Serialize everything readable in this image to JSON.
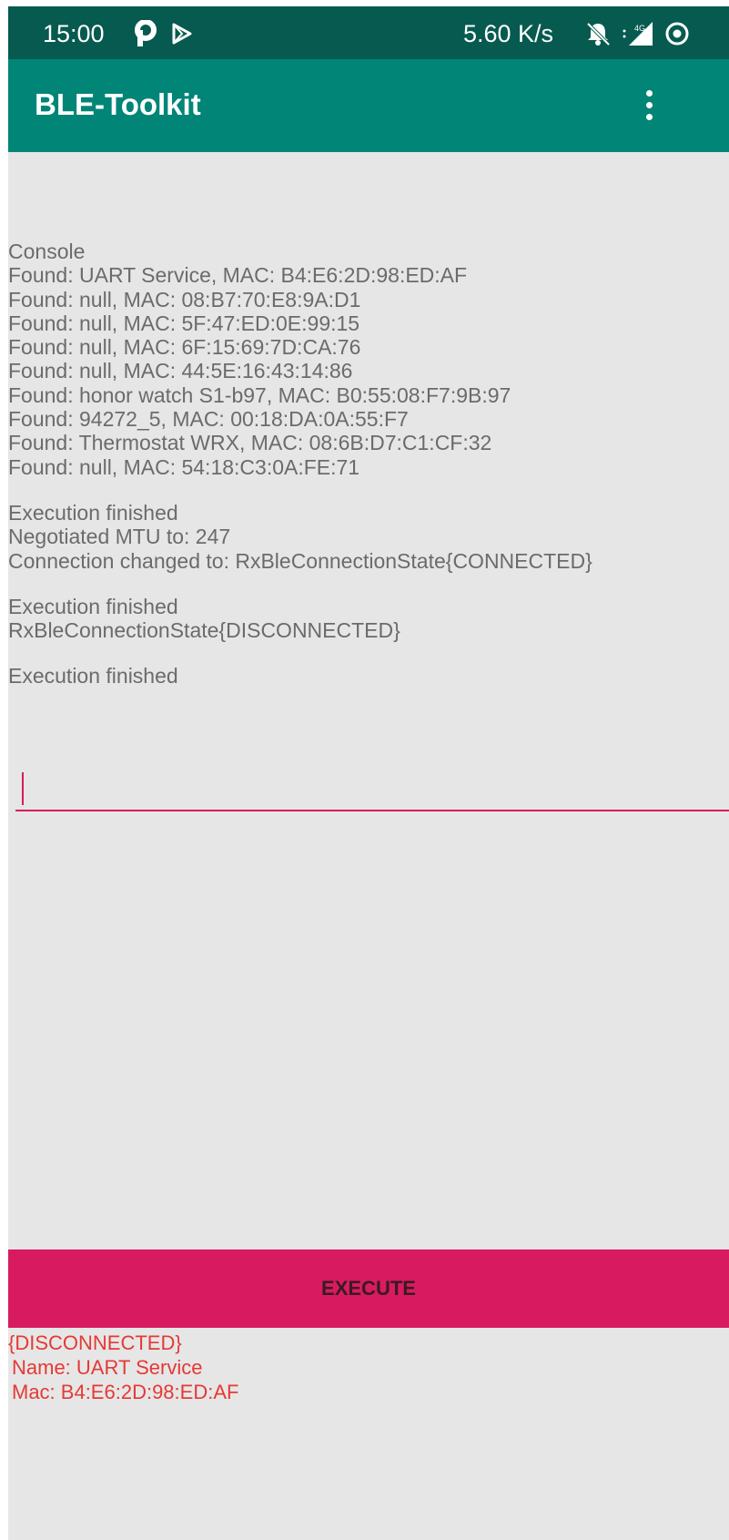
{
  "status_bar": {
    "time": "15:00",
    "net_speed": "5.60 K/s",
    "icons": [
      "parking-p-icon",
      "play-store-icon",
      "bell-off-icon",
      "signal-4g-icon",
      "sync-icon"
    ]
  },
  "app_bar": {
    "title": "BLE-Toolkit",
    "menu_icon": "more-vert-icon"
  },
  "console": {
    "header": "Console",
    "found_devices": [
      "Found: UART Service, MAC: B4:E6:2D:98:ED:AF",
      "Found: null, MAC: 08:B7:70:E8:9A:D1",
      "Found: null, MAC: 5F:47:ED:0E:99:15",
      "Found: null, MAC: 6F:15:69:7D:CA:76",
      "Found: null, MAC: 44:5E:16:43:14:86",
      "Found: honor watch S1-b97, MAC: B0:55:08:F7:9B:97",
      "Found: 94272_5, MAC: 00:18:DA:0A:55:F7",
      "Found: Thermostat WRX, MAC: 08:6B:D7:C1:CF:32",
      "Found: null, MAC: 54:18:C3:0A:FE:71"
    ],
    "block2": [
      "Execution finished",
      "Negotiated MTU to: 247",
      "Connection changed to: RxBleConnectionState{CONNECTED}"
    ],
    "block3": [
      "Execution finished",
      "RxBleConnectionState{DISCONNECTED}"
    ],
    "block4": [
      "Execution finished"
    ]
  },
  "input": {
    "value": ""
  },
  "execute_label": "EXECUTE",
  "device_info": {
    "state": "{DISCONNECTED}",
    "name": "Name: UART Service",
    "mac": "Mac: B4:E6:2D:98:ED:AF"
  },
  "colors": {
    "status_bar": "#075a4f",
    "app_bar": "#008577",
    "accent": "#d81b60",
    "background": "#e6e6e6",
    "console_text": "#6b6b6b",
    "info_text": "#e53935"
  }
}
